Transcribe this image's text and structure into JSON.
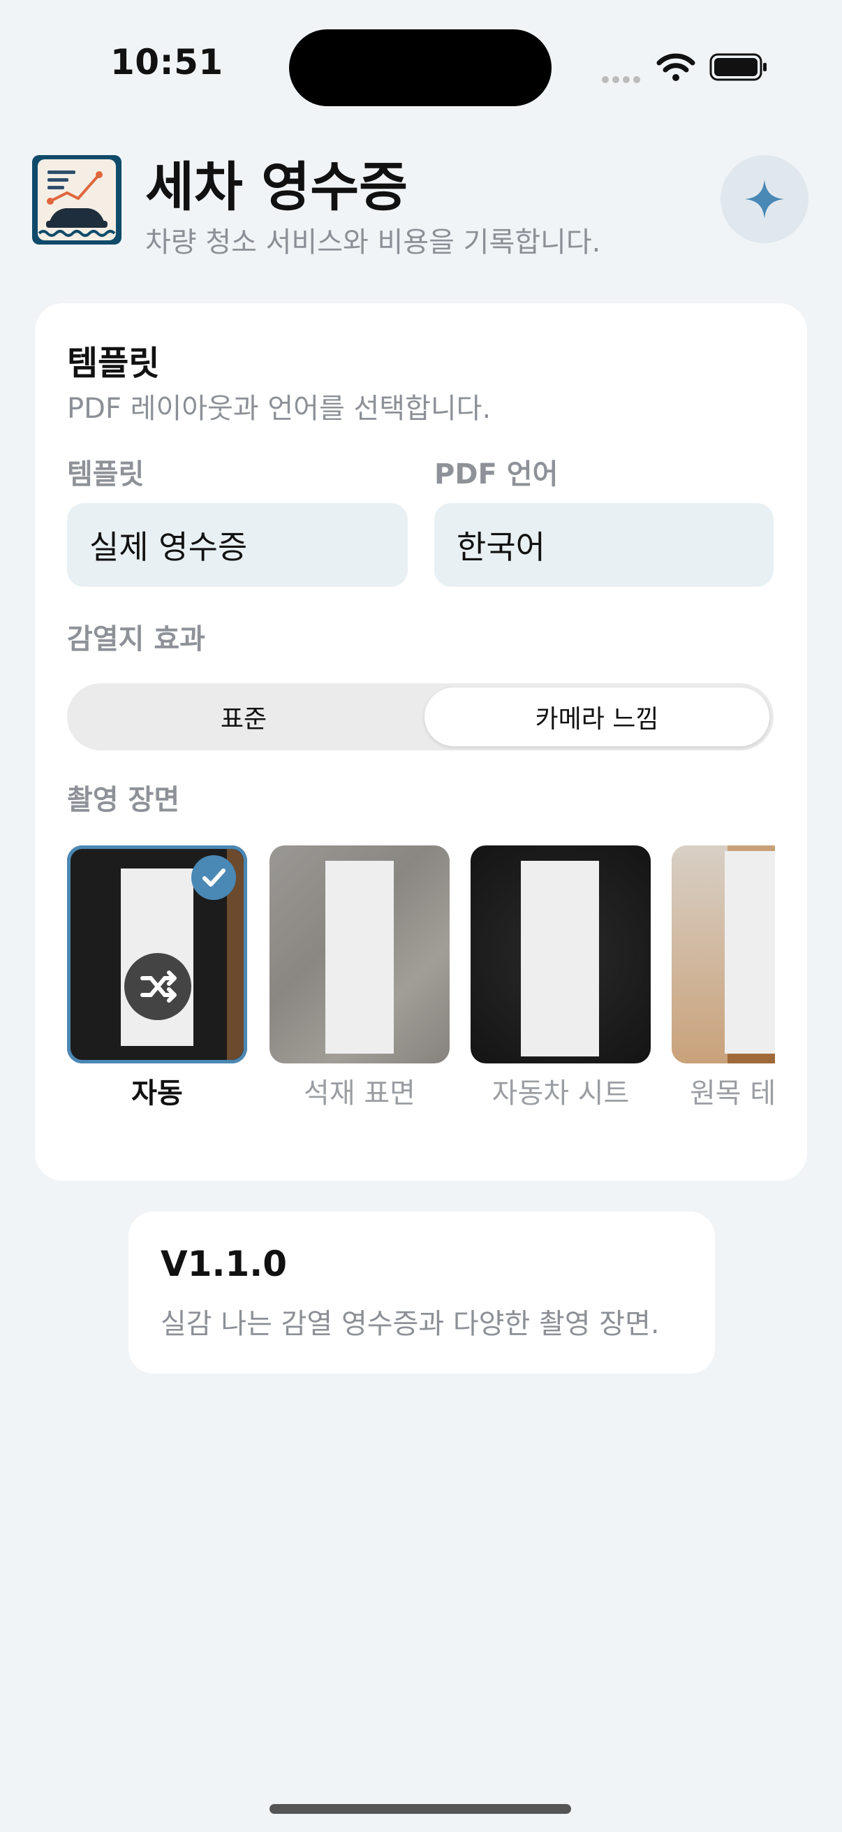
{
  "status_bar": {
    "time": "10:51"
  },
  "header": {
    "title": "세차 영수증",
    "subtitle": "차량 청소 서비스와 비용을 기록합니다.",
    "app_icon": "receipt-car-app-icon",
    "action_icon": "sparkle-icon"
  },
  "template_card": {
    "title": "템플릿",
    "description": "PDF 레이아웃과 언어를 선택합니다.",
    "template_label": "템플릿",
    "template_value": "실제 영수증",
    "language_label": "PDF 언어",
    "language_value": "한국어",
    "thermal_label": "감열지 효과",
    "thermal_options": [
      "표준",
      "카메라 느낌"
    ],
    "thermal_selected": "카메라 느낌",
    "scene_label": "촬영 장면",
    "scenes": [
      {
        "label": "자동",
        "selected": true,
        "icon": "shuffle-icon"
      },
      {
        "label": "석재 표면",
        "selected": false
      },
      {
        "label": "자동차 시트",
        "selected": false
      },
      {
        "label": "원목 테이블",
        "selected": false
      }
    ]
  },
  "version_card": {
    "title": "V1.1.0",
    "description": "실감 나는 감열 영수증과 다양한 촬영 장면."
  },
  "colors": {
    "background": "#F1F4F6",
    "accent": "#4A88B5",
    "field_bg": "#E9F0F3"
  }
}
